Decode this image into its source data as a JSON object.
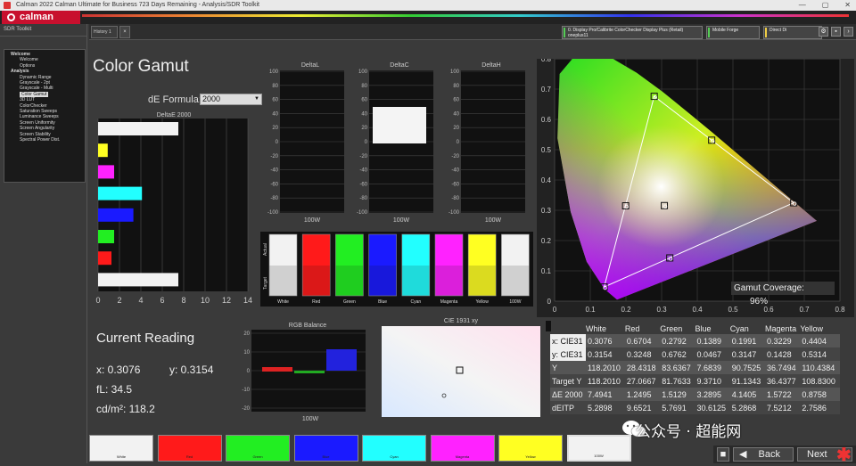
{
  "window": {
    "title": "Calman 2022 Calman Ultimate for Business 723 Days Remaining - Analysis/SDR Toolkit",
    "controls": [
      "—",
      "▢",
      "✕"
    ]
  },
  "app": {
    "logo": "calman"
  },
  "sidebar": {
    "header": "SDR Toolkit",
    "tree": [
      {
        "label": "Welcome",
        "type": "grp"
      },
      {
        "label": "Welcome",
        "type": "it"
      },
      {
        "label": "Options",
        "type": "it"
      },
      {
        "label": "Analysis",
        "type": "grp"
      },
      {
        "label": "Dynamic Range",
        "type": "it"
      },
      {
        "label": "Grayscale - 2pt",
        "type": "it"
      },
      {
        "label": "Grayscale - Multi",
        "type": "it"
      },
      {
        "label": "Color Gamut",
        "type": "it",
        "selected": true
      },
      {
        "label": "3D LUT",
        "type": "it"
      },
      {
        "label": "ColorChecker",
        "type": "it"
      },
      {
        "label": "Saturation Sweeps",
        "type": "it"
      },
      {
        "label": "Luminance Sweeps",
        "type": "it"
      },
      {
        "label": "Screen Uniformity",
        "type": "it"
      },
      {
        "label": "Screen Angularity",
        "type": "it"
      },
      {
        "label": "Screen Stability",
        "type": "it"
      },
      {
        "label": "Spectral Power Dist.",
        "type": "it"
      }
    ]
  },
  "tabs": {
    "history": "History 1",
    "close": "×",
    "devices": [
      {
        "line1": "0. Display Pro/Calibrite ColorChecker Display Plus (Retail)",
        "line2": "oneplus11"
      },
      {
        "line1": "Mobile Forge",
        "line2": ""
      },
      {
        "line1": "Direct Di",
        "line2": ""
      }
    ]
  },
  "page": {
    "title": "Color Gamut",
    "de_formula_label": "dE Formula:",
    "de_formula_value": "2000"
  },
  "colors": {
    "white": "#f2f2f2",
    "red": "#ff1a1a",
    "green": "#22ee22",
    "blue": "#1a1aff",
    "cyan": "#22ffff",
    "magenta": "#ff22ff",
    "yellow": "#ffff22"
  },
  "de2000_chart": {
    "title": "DeltaE 2000",
    "ticks": [
      "0",
      "2",
      "4",
      "6",
      "8",
      "10",
      "12",
      "14"
    ]
  },
  "delta_charts": [
    {
      "title": "DeltaL",
      "xlabel": "100W"
    },
    {
      "title": "DeltaC",
      "xlabel": "100W"
    },
    {
      "title": "DeltaH",
      "xlabel": "100W"
    }
  ],
  "delta_ticks": [
    "100",
    "80",
    "60",
    "40",
    "20",
    "0",
    "-20",
    "-40",
    "-60",
    "-80",
    "-100"
  ],
  "swatch_panel": {
    "actual_label": "Actual",
    "target_label": "Target",
    "labels": [
      "White",
      "Red",
      "Green",
      "Blue",
      "Cyan",
      "Magenta",
      "Yellow",
      "100W"
    ]
  },
  "current_reading": {
    "title": "Current Reading",
    "x": "x: 0.3076",
    "y": "y: 0.3154",
    "fL": "fL: 34.5",
    "cdm2": "cd/m²: 118.2"
  },
  "rgb_balance": {
    "title": "RGB Balance",
    "xlabel": "100W",
    "ticks": [
      "20",
      "10",
      "0",
      "-10",
      "-20"
    ]
  },
  "cie_small": {
    "title": "CIE 1931 xy"
  },
  "cie_large": {
    "title": "CIE 1931 xy",
    "coverage_label": "Gamut Coverage:",
    "coverage_value": "96%",
    "x_ticks": [
      "0",
      "0.1",
      "0.2",
      "0.3",
      "0.4",
      "0.5",
      "0.6",
      "0.7",
      "0.8"
    ],
    "y_ticks": [
      "0.8",
      "0.7",
      "0.6",
      "0.5",
      "0.4",
      "0.3",
      "0.2",
      "0.1",
      "0"
    ]
  },
  "table": {
    "headers": [
      "",
      "White",
      "Red",
      "Green",
      "Blue",
      "Cyan",
      "Magenta",
      "Yellow"
    ],
    "rows": [
      [
        "x: CIE31",
        "0.3076",
        "0.6704",
        "0.2792",
        "0.1389",
        "0.1991",
        "0.3229",
        "0.4404"
      ],
      [
        "y: CIE31",
        "0.3154",
        "0.3248",
        "0.6762",
        "0.0467",
        "0.3147",
        "0.1428",
        "0.5314"
      ],
      [
        "Y",
        "118.2010",
        "28.4318",
        "83.6367",
        "7.6839",
        "90.7525",
        "36.7494",
        "110.4384"
      ],
      [
        "Target Y",
        "118.2010",
        "27.0667",
        "81.7633",
        "9.3710",
        "91.1343",
        "36.4377",
        "108.8300"
      ],
      [
        "ΔE 2000",
        "7.4941",
        "1.2495",
        "1.5129",
        "3.2895",
        "4.1405",
        "1.5722",
        "0.8758"
      ],
      [
        "dEITP",
        "5.2898",
        "9.6521",
        "5.7691",
        "30.6125",
        "5.2868",
        "7.5212",
        "2.7586"
      ]
    ]
  },
  "bottom_swatches": [
    "White",
    "Red",
    "Green",
    "Blue",
    "Cyan",
    "Magenta",
    "Yellow",
    "100W"
  ],
  "footer": {
    "back": "Back",
    "next": "Next"
  },
  "watermark": "公众号 · 超能网"
}
